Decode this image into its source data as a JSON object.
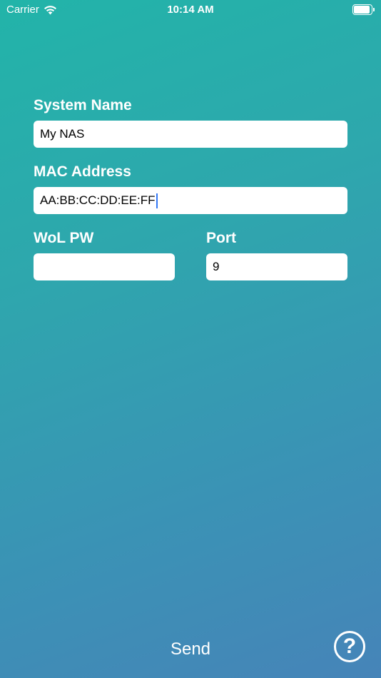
{
  "status_bar": {
    "carrier": "Carrier",
    "time": "10:14 AM",
    "battery_level": 0.9,
    "wifi_icon": "wifi-icon",
    "battery_icon": "battery-icon"
  },
  "form": {
    "system_name": {
      "label": "System Name",
      "value": "My NAS"
    },
    "mac_address": {
      "label": "MAC Address",
      "value": "AA:BB:CC:DD:EE:FF"
    },
    "wol_pw": {
      "label": "WoL PW",
      "value": ""
    },
    "port": {
      "label": "Port",
      "value": "9"
    }
  },
  "footer": {
    "send_label": "Send",
    "help_label": "?",
    "help_icon": "question-circle-icon"
  },
  "colors": {
    "gradient_start": "#22b4a9",
    "gradient_end": "#4684b8",
    "caret": "#3478f6"
  }
}
